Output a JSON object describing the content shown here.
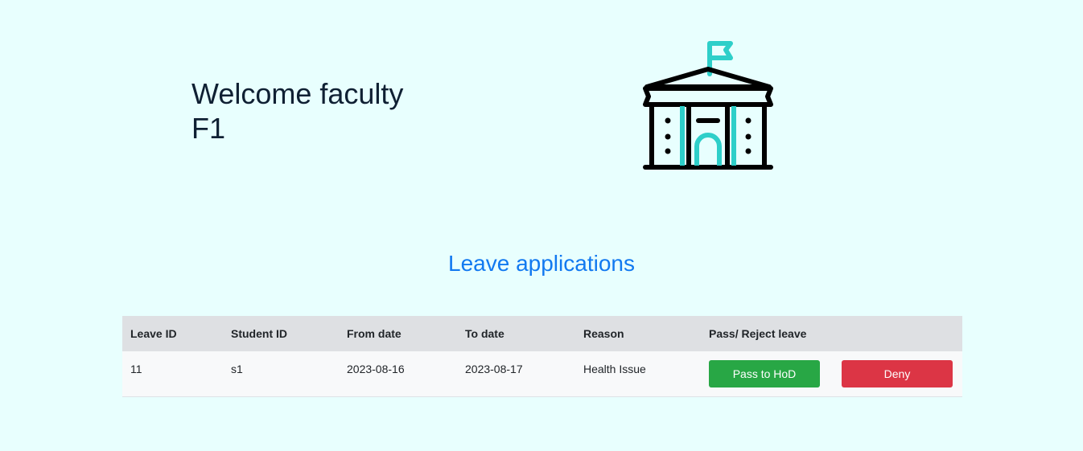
{
  "header": {
    "welcome_text": "Welcome faculty F1",
    "icon": "school-building-icon"
  },
  "section": {
    "title": "Leave applications"
  },
  "table": {
    "columns": [
      "Leave ID",
      "Student ID",
      "From date",
      "To date",
      "Reason",
      "Pass/ Reject leave",
      ""
    ],
    "rows": [
      {
        "leave_id": "11",
        "student_id": "s1",
        "from_date": "2023-08-16",
        "to_date": "2023-08-17",
        "reason": "Health Issue",
        "pass_label": "Pass to HoD",
        "deny_label": "Deny"
      }
    ]
  },
  "colors": {
    "background": "#e8fffe",
    "accent": "#1279f0",
    "icon_teal": "#2ecfc9",
    "pass": "#28a745",
    "deny": "#dc3545"
  }
}
